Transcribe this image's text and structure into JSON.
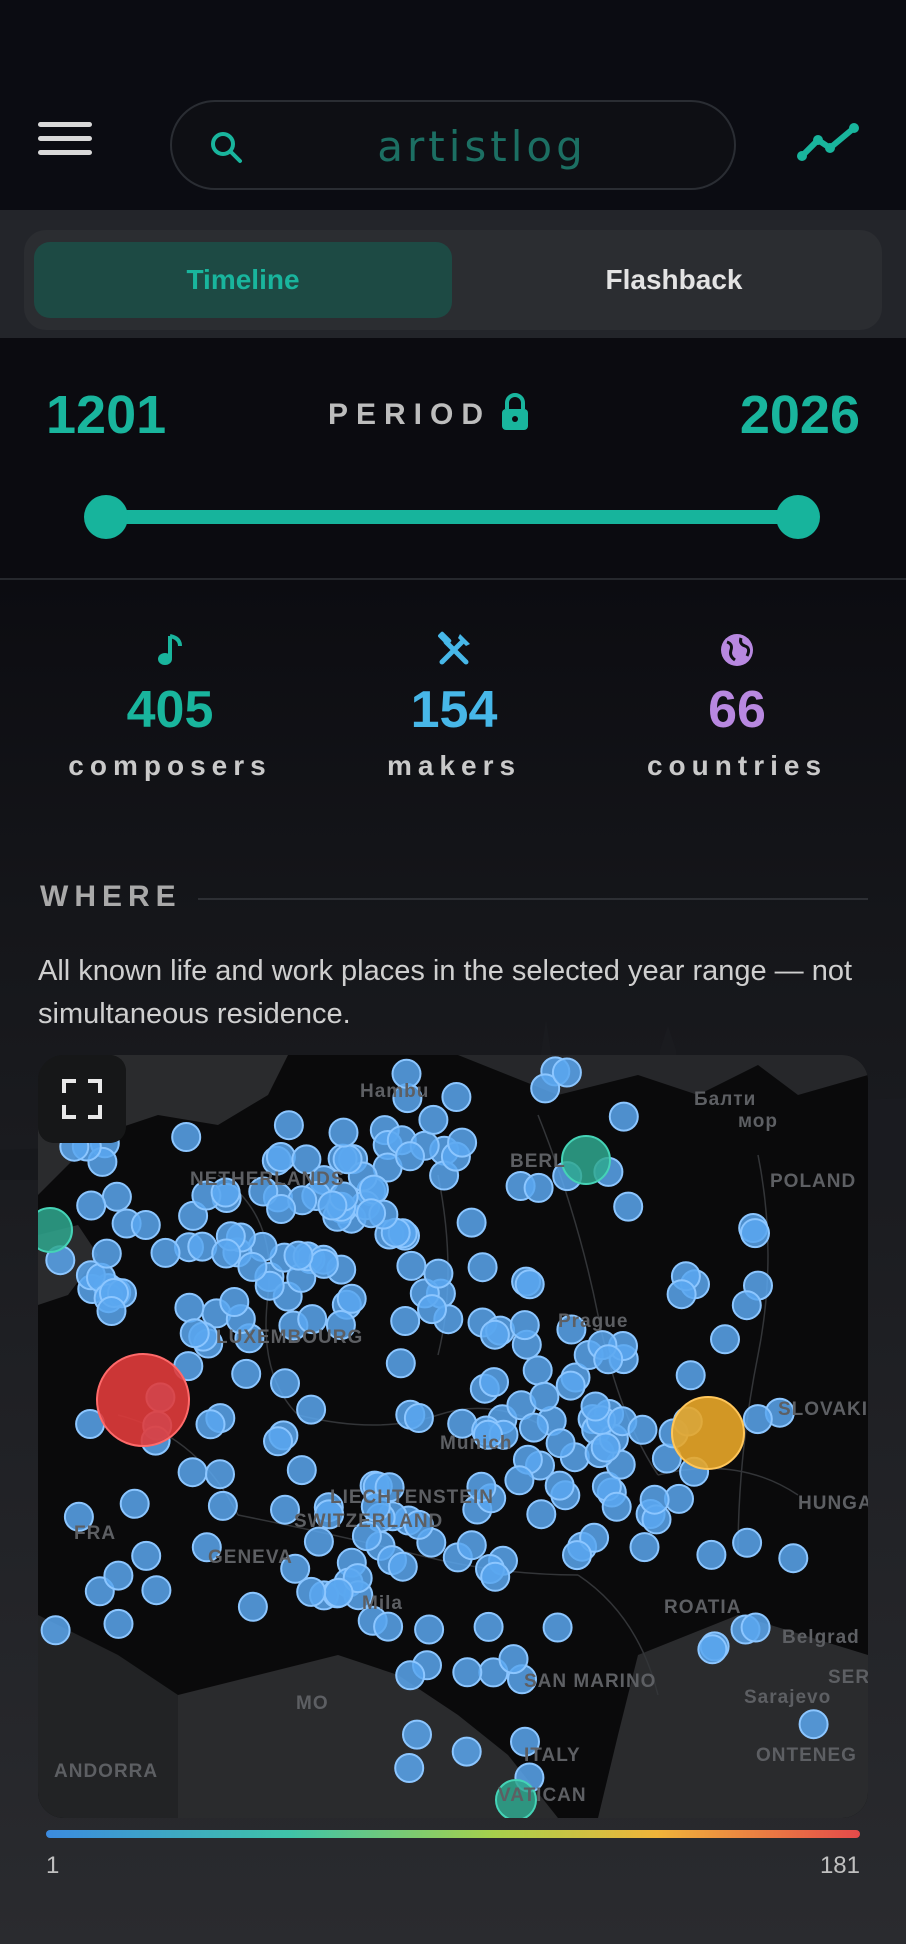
{
  "app": {
    "search_placeholder": "artistlog"
  },
  "tabs": [
    {
      "label": "Timeline",
      "active": true
    },
    {
      "label": "Flashback",
      "active": false
    }
  ],
  "period": {
    "label": "PERIOD",
    "start": "1201",
    "end": "2026",
    "locked": true,
    "range_selected": [
      1201,
      2026
    ]
  },
  "stats": [
    {
      "icon": "music-note-icon",
      "value": "405",
      "label": "composers",
      "color": "#19b59d"
    },
    {
      "icon": "tools-icon",
      "value": "154",
      "label": "makers",
      "color": "#47b7e8"
    },
    {
      "icon": "globe-icon",
      "value": "66",
      "label": "countries",
      "color": "#b888e0"
    }
  ],
  "where": {
    "heading": "WHERE",
    "description": "All known life and work places in the selected year range — not simultaneous residence."
  },
  "map": {
    "labels": [
      "Hambu",
      "Балти",
      "мор",
      "BERL",
      "POLAND",
      "NETHERLANDS",
      "LUXEMBOURG",
      "Prague",
      "SLOVAKI",
      "Munich",
      "SWITZERLAND",
      "LIECHTENSTEIN",
      "GENEVA",
      "HUNGAR",
      "FRA",
      "Mila",
      "ROATIA",
      "Belgrad",
      "SER",
      "Sarajevo",
      "MO",
      "SAN MARINO",
      "ITALY",
      "ANDORRA",
      "VATICAN",
      "ONTENEG"
    ],
    "legend": {
      "min": "1",
      "max": "181"
    },
    "colors": {
      "low": "#5aa7f0",
      "mid": "#2fa88f",
      "high_mid": "#e8a628",
      "high": "#e03b3b"
    }
  }
}
